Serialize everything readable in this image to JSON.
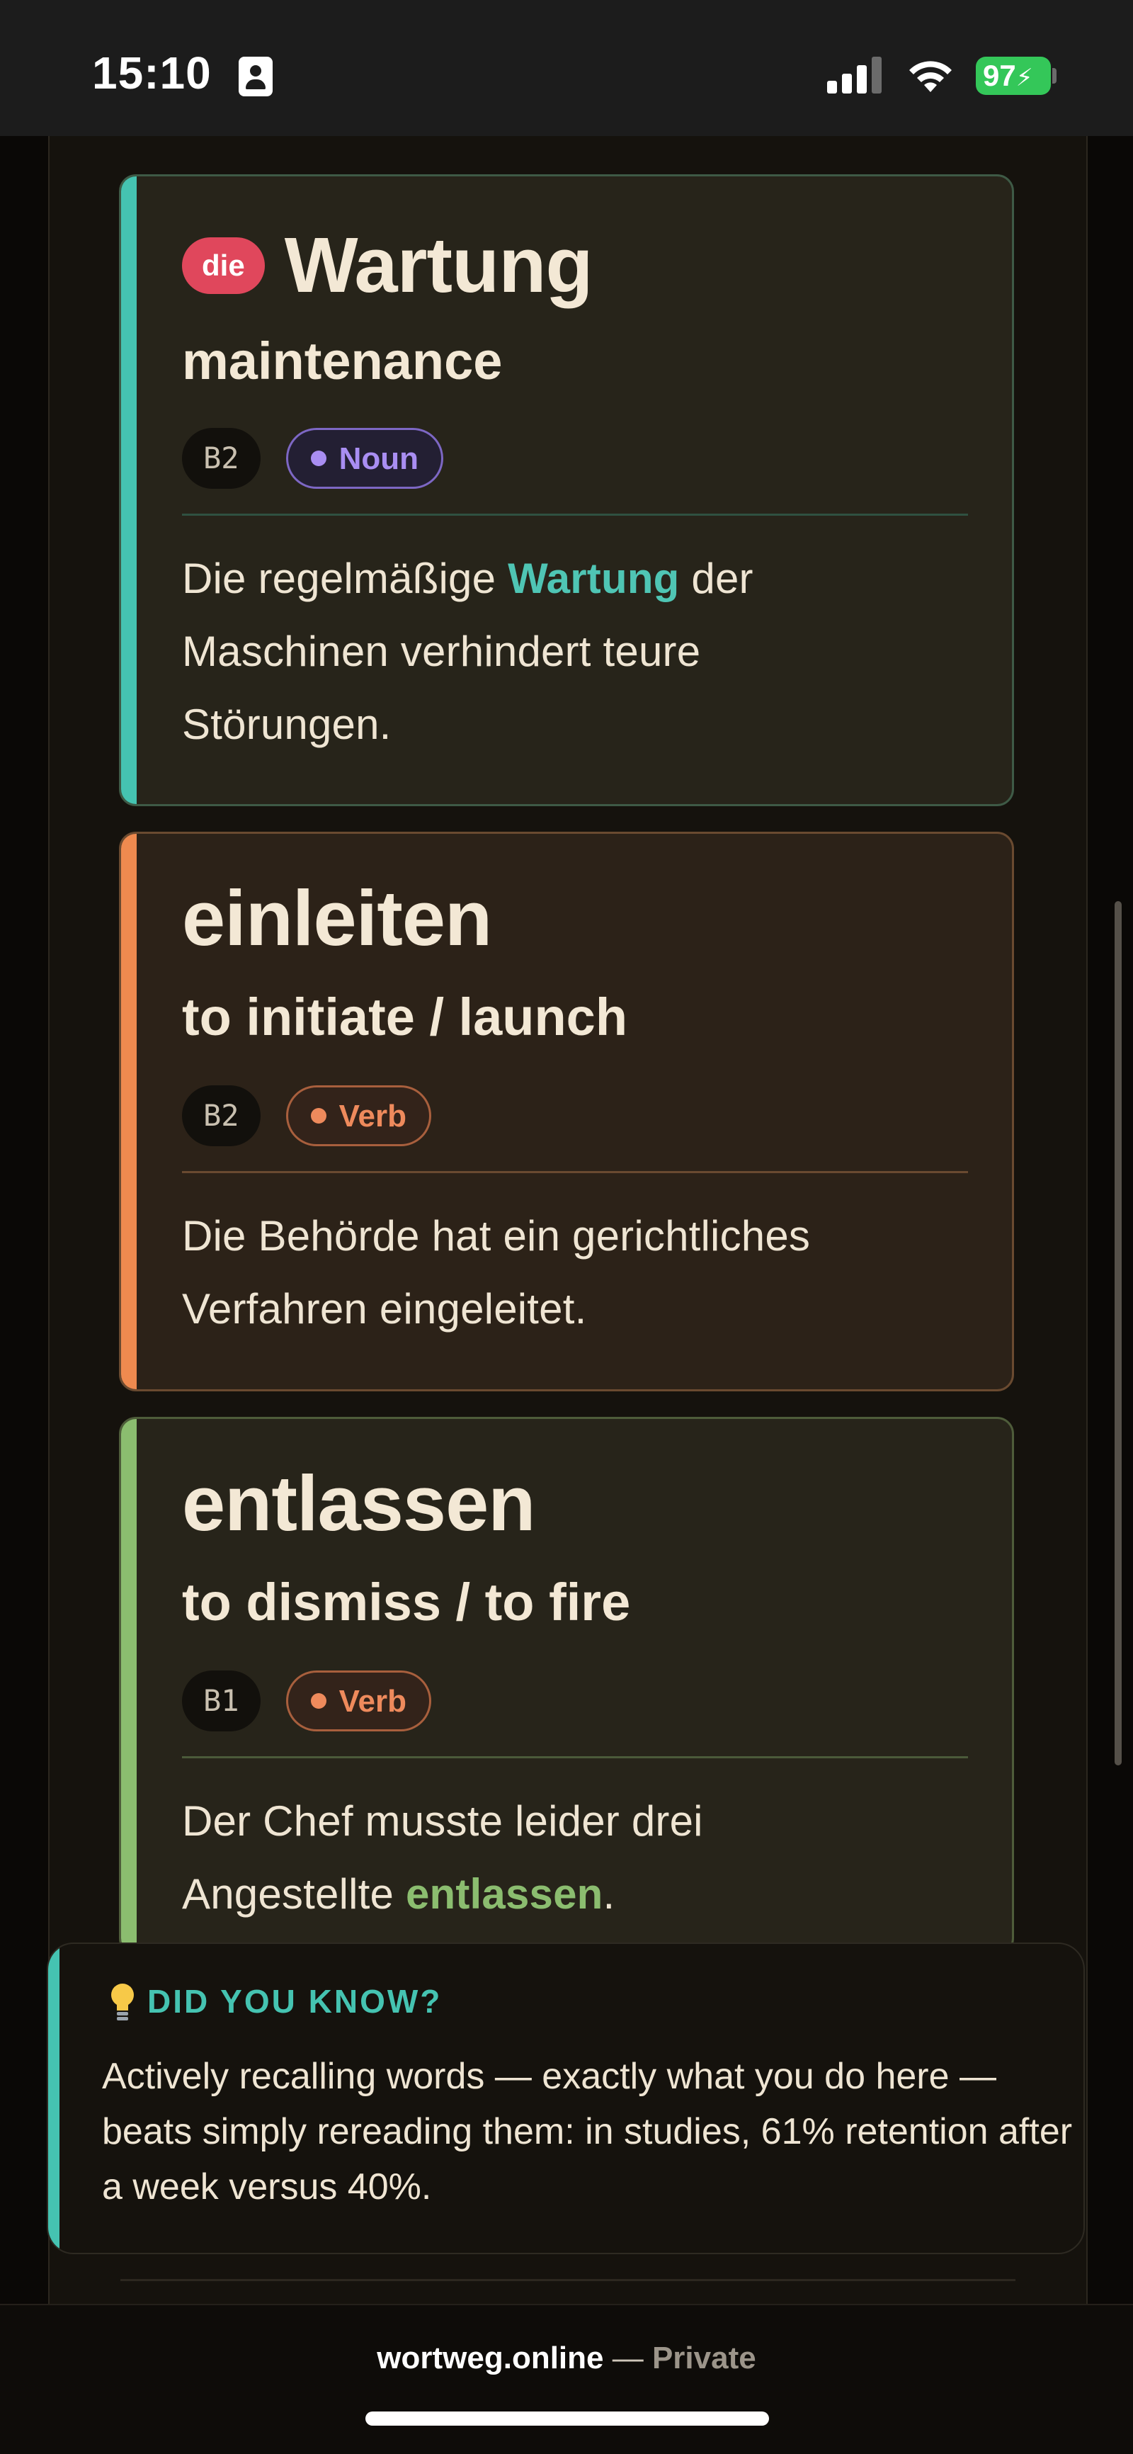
{
  "status_bar": {
    "time": "15:10",
    "battery": "97",
    "icons": [
      "contact-card-icon",
      "cellular-signal-icon",
      "wifi-icon",
      "battery-charging-icon"
    ]
  },
  "cards": [
    {
      "article": "die",
      "word": "Wartung",
      "translation": "maintenance",
      "level": "B2",
      "pos": "Noun",
      "example_before": "Die regelmäßige ",
      "example_highlight": "Wartung",
      "example_after": " der Maschinen verhindert teure Störungen.",
      "accent_color": "#45c3b1"
    },
    {
      "word": "einleiten",
      "translation": "to initiate / launch",
      "level": "B2",
      "pos": "Verb",
      "example": "Die Behörde hat ein gerichtliches Verfahren eingeleitet.",
      "accent_color": "#ef8a4f"
    },
    {
      "word": "entlassen",
      "translation": "to dismiss / to fire",
      "level": "B1",
      "pos": "Verb",
      "example_before": "Der Chef musste leider drei Angestellte ",
      "example_highlight": "entlassen",
      "example_after": ".",
      "accent_color": "#8bbd6f"
    }
  ],
  "tip": {
    "title": "DID YOU KNOW?",
    "icon": "lightbulb-icon",
    "text": "Actively recalling words — exactly what you do here — beats simply rereading them: in studies, 61% retention after a week versus 40%."
  },
  "browser": {
    "domain": "wortweg.online",
    "separator": " — ",
    "mode": "Private"
  }
}
